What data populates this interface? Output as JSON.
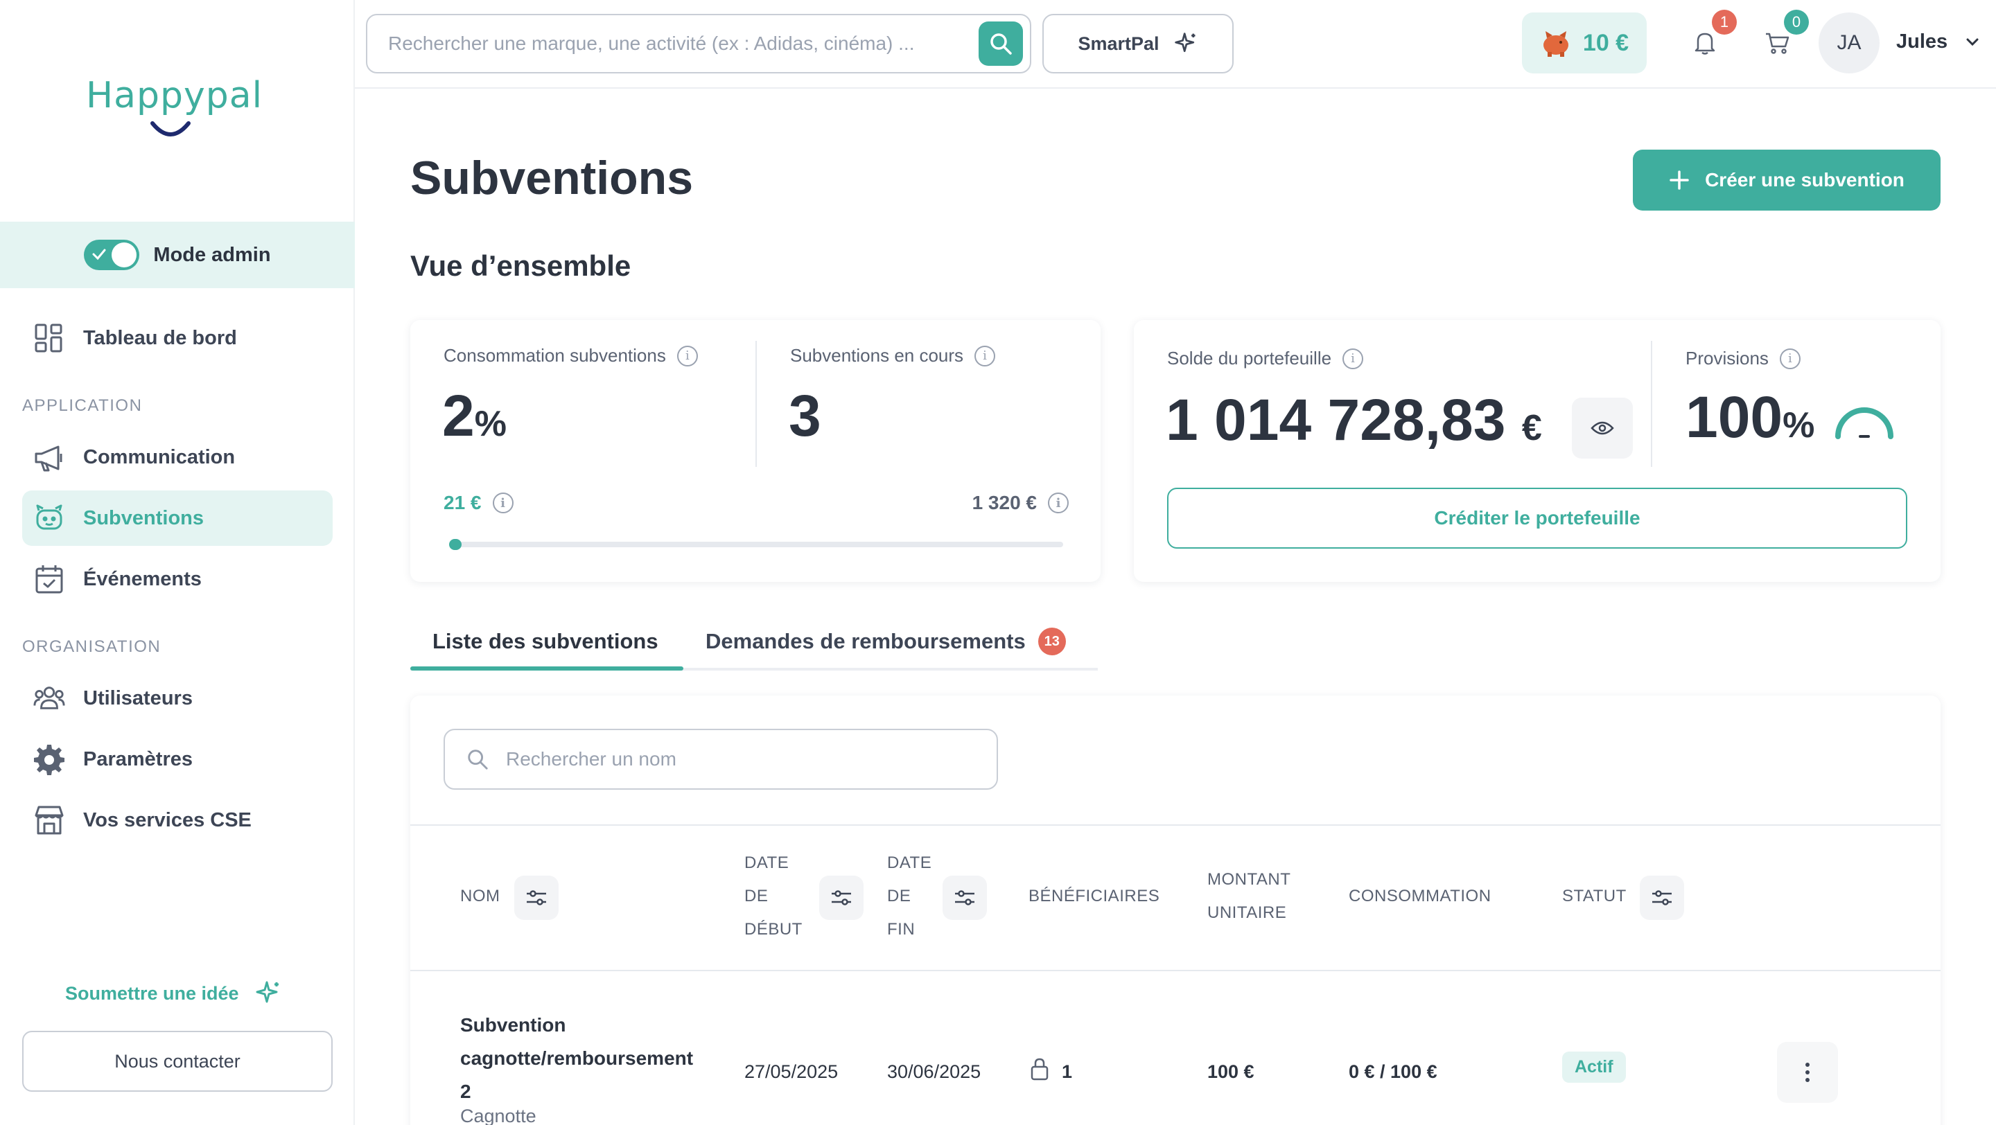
{
  "brand": {
    "logo_text": "Happypal",
    "accent": "#3fae9e",
    "badge_color": "#e46a5a"
  },
  "sidebar": {
    "admin_mode_label": "Mode admin",
    "admin_mode_on": true,
    "dashboard": {
      "label": "Tableau de bord",
      "icon": "dashboard-grid-icon"
    },
    "section_application": "APPLICATION",
    "application_items": [
      {
        "label": "Communication",
        "icon": "megaphone-icon",
        "active": false
      },
      {
        "label": "Subventions",
        "icon": "piggy-bank-icon",
        "active": true
      },
      {
        "label": "Événements",
        "icon": "calendar-icon",
        "active": false
      }
    ],
    "section_organisation": "ORGANISATION",
    "organisation_items": [
      {
        "label": "Utilisateurs",
        "icon": "users-icon"
      },
      {
        "label": "Paramètres",
        "icon": "gear-icon"
      },
      {
        "label": "Vos services CSE",
        "icon": "store-icon"
      }
    ],
    "idea_label": "Soumettre une idée",
    "contact_label": "Nous contacter"
  },
  "topbar": {
    "search_placeholder": "Rechercher une marque, une activité (ex : Adidas, cinéma) ...",
    "smartpal_label": "SmartPal",
    "wallet_amount": "10 €",
    "notifications_count": "1",
    "cart_count": "0",
    "avatar_initials": "JA",
    "user_name": "Jules"
  },
  "main": {
    "title": "Subventions",
    "create_button": "Créer une subvention",
    "overview_title": "Vue d’ensemble",
    "consumption": {
      "label": "Consommation subventions",
      "value": "2",
      "unit": "%",
      "used": "21 €",
      "total": "1 320 €",
      "progress": 0.02
    },
    "ongoing": {
      "label": "Subventions en cours",
      "value": "3"
    },
    "wallet": {
      "label": "Solde du portefeuille",
      "value": "1 014 728,83",
      "unit": "€",
      "credit_button": "Créditer le portefeuille"
    },
    "provisions": {
      "label": "Provisions",
      "value": "100",
      "unit": "%"
    },
    "tabs": [
      {
        "label": "Liste des subventions",
        "active": true
      },
      {
        "label": "Demandes de remboursements",
        "count": "13",
        "active": false
      }
    ],
    "table": {
      "search_placeholder": "Rechercher un nom",
      "columns": {
        "name": "NOM",
        "start_date": [
          "DATE",
          "DE",
          "DÉBUT"
        ],
        "end_date": [
          "DATE",
          "DE",
          "FIN"
        ],
        "beneficiaries": "BÉNÉFICIAIRES",
        "unit_amount": [
          "MONTANT",
          "UNITAIRE"
        ],
        "consumption": "CONSOMMATION",
        "status": "STATUT"
      },
      "rows": [
        {
          "name_lines": [
            "Subvention",
            "cagnotte/remboursement",
            "2"
          ],
          "type": "Cagnotte",
          "start_date": "27/05/2025",
          "end_date": "30/06/2025",
          "beneficiaries": "1",
          "unit_amount": "100 €",
          "consumption": "0 € / 100 €",
          "status": "Actif"
        }
      ]
    }
  }
}
